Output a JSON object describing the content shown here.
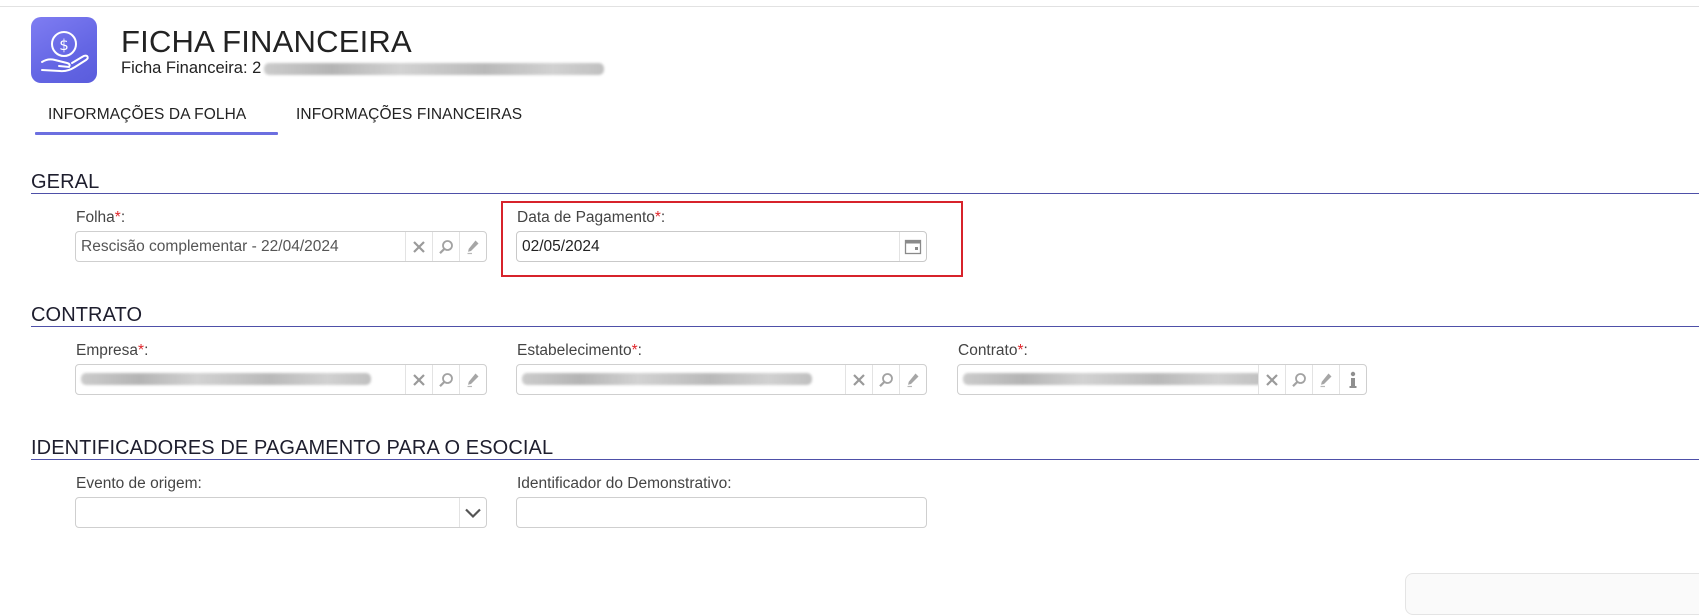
{
  "header": {
    "title": "FICHA FINANCEIRA",
    "subtitle_label": "Ficha Financeira:",
    "subtitle_value_prefix": "2"
  },
  "tabs": [
    {
      "label": "INFORMAÇÕES DA FOLHA",
      "active": true
    },
    {
      "label": "INFORMAÇÕES FINANCEIRAS",
      "active": false
    }
  ],
  "sections": {
    "geral": {
      "title": "GERAL",
      "folha": {
        "label": "Folha",
        "required_mark": "*",
        "colon": ":",
        "value": "Rescisão complementar - 22/04/2024"
      },
      "data_pagamento": {
        "label": "Data de Pagamento",
        "required_mark": "*",
        "colon": ":",
        "value": "02/05/2024"
      }
    },
    "contrato": {
      "title": "CONTRATO",
      "empresa": {
        "label": "Empresa",
        "required_mark": "*",
        "colon": ":"
      },
      "estabelecimento": {
        "label": "Estabelecimento",
        "required_mark": "*",
        "colon": ":"
      },
      "contrato": {
        "label": "Contrato",
        "required_mark": "*",
        "colon": ":"
      }
    },
    "esocial": {
      "title": "IDENTIFICADORES DE PAGAMENTO PARA O ESOCIAL",
      "evento_origem": {
        "label": "Evento de origem:",
        "value": ""
      },
      "identificador_demonstrativo": {
        "label": "Identificador do Demonstrativo:",
        "value": ""
      }
    }
  },
  "icons": {
    "app": "hand-dollar-icon",
    "clear": "clear-x-icon",
    "search": "magnifier-icon",
    "edit": "pencil-icon",
    "calendar": "calendar-icon",
    "info": "info-icon",
    "dropdown": "chevron-down-icon"
  },
  "colors": {
    "accent": "#6c6fe0",
    "required": "#e0252a",
    "highlight_border": "#d7232b",
    "section_rule": "#4e50a8"
  }
}
